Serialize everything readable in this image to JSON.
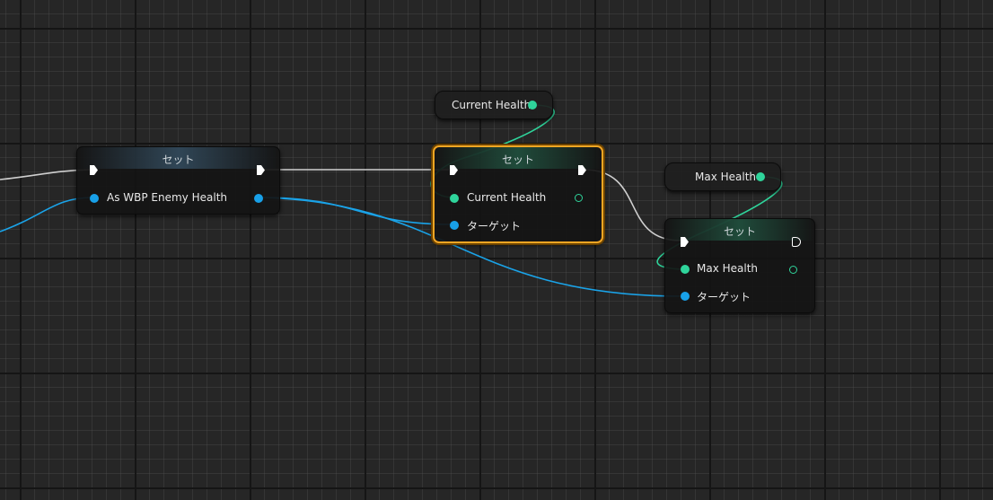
{
  "colors": {
    "exec_wire": "#d9d9d9",
    "object_wire": "#1aa3e8",
    "float_wire": "#2fd49b",
    "selection": "#f5a623"
  },
  "nodes": [
    {
      "id": "set1",
      "title": "セット",
      "pins": {
        "input": "As WBP Enemy Health"
      }
    },
    {
      "id": "set2",
      "title": "セット",
      "selected": true,
      "pins": {
        "value": "Current Health",
        "target": "ターゲット"
      }
    },
    {
      "id": "set3",
      "title": "セット",
      "pins": {
        "value": "Max Health",
        "target": "ターゲット"
      }
    }
  ],
  "variables": [
    {
      "id": "getCurrentHealth",
      "label": "Current Health"
    },
    {
      "id": "getMaxHealth",
      "label": "Max Health"
    }
  ]
}
